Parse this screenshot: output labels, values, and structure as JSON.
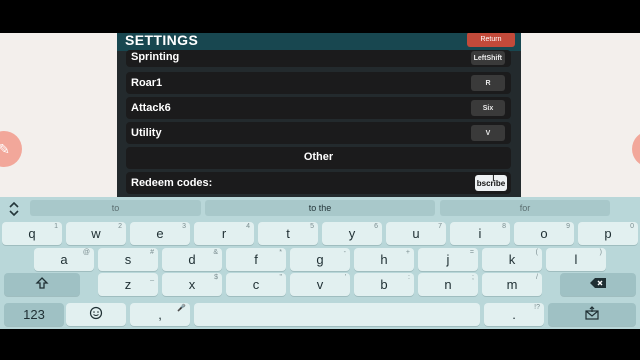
{
  "settings": {
    "title": "SETTINGS",
    "return_label": "Return",
    "rows": [
      {
        "label": "Sprinting",
        "key": "LeftShift"
      },
      {
        "label": "Roar1",
        "key": "R"
      },
      {
        "label": "Attack6",
        "key": "Six"
      },
      {
        "label": "Utility",
        "key": "V"
      }
    ],
    "section_other": "Other",
    "redeem_label": "Redeem codes:",
    "redeem_value": "bscribe"
  },
  "keyboard": {
    "suggestions": [
      "to",
      "to the",
      "for"
    ],
    "row1": [
      {
        "k": "q",
        "s": "1"
      },
      {
        "k": "w",
        "s": "2"
      },
      {
        "k": "e",
        "s": "3"
      },
      {
        "k": "r",
        "s": "4"
      },
      {
        "k": "t",
        "s": "5"
      },
      {
        "k": "y",
        "s": "6"
      },
      {
        "k": "u",
        "s": "7"
      },
      {
        "k": "i",
        "s": "8"
      },
      {
        "k": "o",
        "s": "9"
      },
      {
        "k": "p",
        "s": "0"
      }
    ],
    "row2": [
      {
        "k": "a",
        "s": "@"
      },
      {
        "k": "s",
        "s": "#"
      },
      {
        "k": "d",
        "s": "&"
      },
      {
        "k": "f",
        "s": "*"
      },
      {
        "k": "g",
        "s": "-"
      },
      {
        "k": "h",
        "s": "+"
      },
      {
        "k": "j",
        "s": "="
      },
      {
        "k": "k",
        "s": "("
      },
      {
        "k": "l",
        "s": ")"
      }
    ],
    "row3": [
      {
        "k": "z",
        "s": "_"
      },
      {
        "k": "x",
        "s": "$"
      },
      {
        "k": "c",
        "s": "\""
      },
      {
        "k": "v",
        "s": "'"
      },
      {
        "k": "b",
        "s": ":"
      },
      {
        "k": "n",
        "s": ";"
      },
      {
        "k": "m",
        "s": "/"
      }
    ],
    "num_label": "123",
    "comma": ",",
    "period": ".",
    "period_sup": "!?",
    "icons": {
      "toggle": "expand-collapse-icon",
      "shift": "shift-icon",
      "backspace": "backspace-icon",
      "emoji": "emoji-icon",
      "mic": "microphone-icon",
      "enter": "send-mail-icon"
    }
  },
  "colors": {
    "panel_bg": "#232a2d",
    "header_bg": "#184750",
    "return_bg": "#c24a3a",
    "keyboard_bg": "#b9d7d9",
    "key_bg": "#e2f0f0"
  }
}
